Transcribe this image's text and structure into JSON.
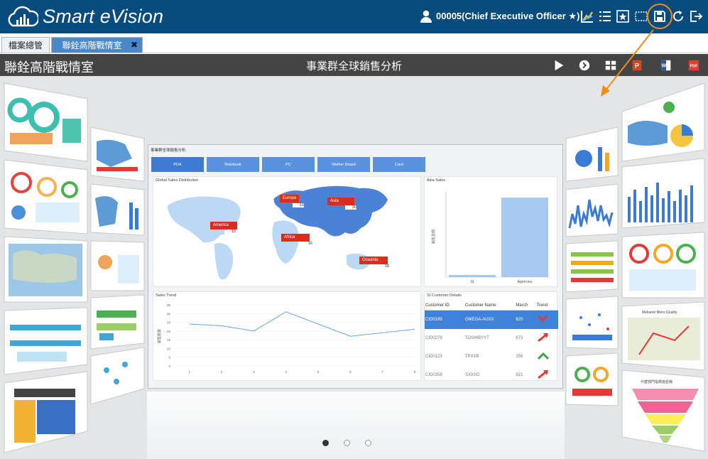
{
  "app": {
    "logo_text": "Smart eVision",
    "user_label": "00005(Chief Executive Officer ★)"
  },
  "toolbar": {
    "icons": [
      "chart-icon",
      "list-icon",
      "star-frame-icon",
      "fullscreen-icon",
      "save-icon",
      "refresh-icon",
      "logout-icon"
    ]
  },
  "tabs": [
    {
      "label": "檔案總管"
    },
    {
      "label": "聯銓高階戰情室",
      "close": "✖"
    }
  ],
  "header": {
    "title": "聯銓高階戰情室",
    "subtitle": "事業群全球銷售分析",
    "actions": [
      "play-icon",
      "next-icon",
      "grid-icon",
      "ppt-icon",
      "word-icon",
      "pdf-icon"
    ],
    "action_labels": {
      "ppt": "P",
      "word": "W",
      "pdf": "PDF"
    }
  },
  "dashboard": {
    "title": "事業群全球銷售分析",
    "products": [
      "PDA",
      "Notebook",
      "PC",
      "Mother Board",
      "Card"
    ],
    "selected_product": "PDA",
    "map": {
      "title": "Global Sales Distribution",
      "regions": [
        {
          "name": "Europe",
          "value": "10"
        },
        {
          "name": "Asia",
          "value": "30"
        },
        {
          "name": "America",
          "value": "15"
        },
        {
          "name": "Africa",
          "value": "16"
        },
        {
          "name": "Oceania",
          "value": "18"
        }
      ]
    },
    "asia_sales": {
      "title": "Asia Sales",
      "y_label": "銷售金額",
      "categories": [
        "SI",
        "Agencies"
      ],
      "values": [
        1,
        37
      ]
    },
    "trend": {
      "title": "Sales Trend",
      "y_label": "銷售數量",
      "y_ticks": [
        "35",
        "30",
        "25",
        "20",
        "15",
        "10",
        "5",
        "0"
      ],
      "x": [
        "1",
        "2",
        "3",
        "4",
        "5",
        "6",
        "7",
        "8"
      ],
      "values": [
        24,
        23,
        20,
        31,
        24,
        17,
        19,
        21
      ]
    },
    "customers": {
      "title": "SI Customer Details",
      "columns": [
        "Customer ID",
        "Customer Name",
        "March",
        "Trend"
      ],
      "rows": [
        {
          "id": "CID0199",
          "name": "OMEGA-AUXX",
          "march": "620",
          "trend": "down"
        },
        {
          "id": "CID0278",
          "name": "TOSHIBYYT",
          "march": "873",
          "trend": "up"
        },
        {
          "id": "CID0123",
          "name": "TPXXB",
          "march": "156",
          "trend": "flat"
        },
        {
          "id": "CID0358",
          "name": "SXXXD",
          "march": "921",
          "trend": "up"
        }
      ],
      "selected_row": 0
    }
  },
  "side_thumbs": {
    "right_labels": [
      "Mekanet filters Quality",
      "什麼部門指標值名稱"
    ]
  },
  "pager": {
    "count": 3,
    "active": 0
  },
  "colors": {
    "topbar": "#084c7e",
    "accent": "#f28a1a",
    "tab_active": "#4a88c9",
    "header": "#444444"
  }
}
